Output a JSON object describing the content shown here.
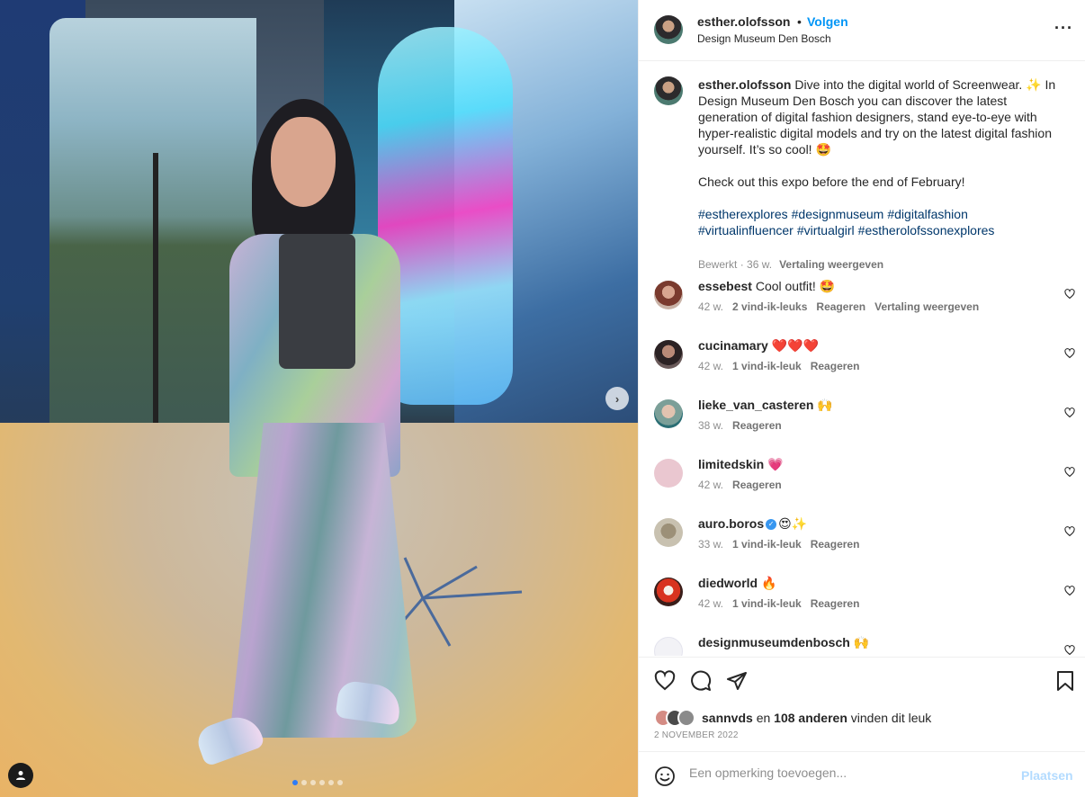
{
  "post": {
    "username": "esther.olofsson",
    "follow_label": "Volgen",
    "separator": "•",
    "location": "Design Museum Den Bosch",
    "more_icon": "more-horizontal-icon"
  },
  "media": {
    "carousel_total": 6,
    "carousel_active": 1,
    "next_icon": "chevron-right-icon",
    "tag_icon": "user-tag-icon"
  },
  "caption": {
    "username": "esther.olofsson",
    "text": "Dive into the digital world of Screenwear. ✨ In Design Museum Den Bosch you can discover the latest generation of digital fashion designers, stand eye-to-eye with hyper-realistic digital models and try on the latest digital fashion yourself. It’s so cool! 🤩\n\nCheck out this expo before the end of February!",
    "hashtags": [
      "#estherexplores",
      "#designmuseum",
      "#digitalfashion",
      "#virtualinfluencer",
      "#virtualgirl",
      "#estherolofssonexplores"
    ],
    "edited": "Bewerkt",
    "age": "36 w.",
    "translate": "Vertaling weergeven"
  },
  "comments": [
    {
      "user": "essebest",
      "text": "Cool outfit! 🤩",
      "age": "42 w.",
      "likes": "2 vind-ik-leuks",
      "reply": "Reageren",
      "translate": "Vertaling weergeven",
      "verified": false
    },
    {
      "user": "cucinamary",
      "text": "❤️❤️❤️",
      "age": "42 w.",
      "likes": "1 vind-ik-leuk",
      "reply": "Reageren",
      "translate": "",
      "verified": false
    },
    {
      "user": "lieke_van_casteren",
      "text": "🙌",
      "age": "38 w.",
      "likes": "",
      "reply": "Reageren",
      "translate": "",
      "verified": false
    },
    {
      "user": "limitedskin",
      "text": "💗",
      "age": "42 w.",
      "likes": "",
      "reply": "Reageren",
      "translate": "",
      "verified": false
    },
    {
      "user": "auro.boros",
      "text": "😍✨",
      "age": "33 w.",
      "likes": "1 vind-ik-leuk",
      "reply": "Reageren",
      "translate": "",
      "verified": true
    },
    {
      "user": "diedworld",
      "text": "🔥",
      "age": "42 w.",
      "likes": "1 vind-ik-leuk",
      "reply": "Reageren",
      "translate": "",
      "verified": false
    },
    {
      "user": "designmuseumdenbosch",
      "text": "🙌",
      "age": "",
      "likes": "",
      "reply": "",
      "translate": "",
      "verified": false
    }
  ],
  "actions": {
    "like_icon": "heart-icon",
    "comment_icon": "comment-icon",
    "share_icon": "send-icon",
    "save_icon": "bookmark-icon"
  },
  "likes": {
    "first_user": "sannvds",
    "connector": "en",
    "others": "108 anderen",
    "suffix": "vinden dit leuk"
  },
  "date": "2 NOVEMBER 2022",
  "add_comment": {
    "placeholder": "Een opmerking toevoegen...",
    "post_label": "Plaatsen",
    "emoji_icon": "smiley-icon"
  },
  "colors": {
    "accent": "#0095f6",
    "hashtag": "#00376b",
    "muted": "#8e8e8e",
    "post_disabled": "#b3dbff"
  }
}
